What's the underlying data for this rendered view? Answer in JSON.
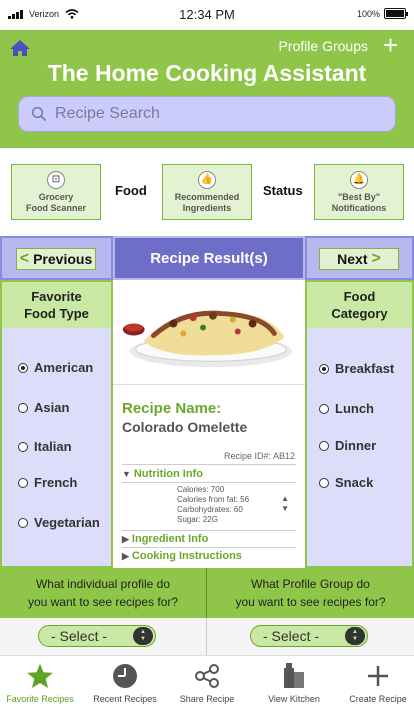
{
  "status_bar": {
    "carrier": "Verizon",
    "time": "12:34 PM",
    "battery": "100%"
  },
  "header": {
    "profile_groups": "Profile Groups",
    "title": "The Home Cooking Assistant",
    "search_placeholder": "Recipe Search"
  },
  "features": {
    "grocery_line1": "Grocery",
    "grocery_line2": "Food Scanner",
    "food_label": "Food",
    "recommended_line1": "Recommended",
    "recommended_line2": "Ingredients",
    "status_label": "Status",
    "bestby_line1": "\"Best By\"",
    "bestby_line2": "Notifications"
  },
  "nav": {
    "previous": "Previous",
    "title": "Recipe Result(s)",
    "next": "Next"
  },
  "favorite_food_type": {
    "header_line1": "Favorite",
    "header_line2": "Food Type",
    "options": [
      "American",
      "Asian",
      "Italian",
      "French",
      "Vegetarian"
    ],
    "selected": "American"
  },
  "food_category": {
    "header_line1": "Food",
    "header_line2": "Category",
    "options": [
      "Breakfast",
      "Lunch",
      "Dinner",
      "Snack"
    ],
    "selected": "Breakfast"
  },
  "recipe": {
    "name_label": "Recipe Name:",
    "name": "Colorado Omelette",
    "id": "Recipe ID#: AB12",
    "nutrition_label": "Nutrition Info",
    "nutrition": [
      "Calories: 700",
      "Calories from fat: 56",
      "Carbohydrates: 60",
      "Sugar: 22G"
    ],
    "ingredient_label": "Ingredient Info",
    "instructions_label": "Cooking Instructions"
  },
  "questions": {
    "profile_q_line1": "What individual profile do",
    "profile_q_line2": "you want to see recipes for?",
    "group_q_line1": "What Profile Group do",
    "group_q_line2": "you want to see recipes for?",
    "select_label": "- Select -"
  },
  "tabs": {
    "favorite": "Favorite Recipes",
    "recent": "Recent Recipes",
    "share": "Share Recipe",
    "kitchen": "View Kitchen",
    "create": "Create Recipe"
  },
  "colors": {
    "primary_green": "#8fc64a",
    "accent_purple": "#6e6ec8"
  }
}
